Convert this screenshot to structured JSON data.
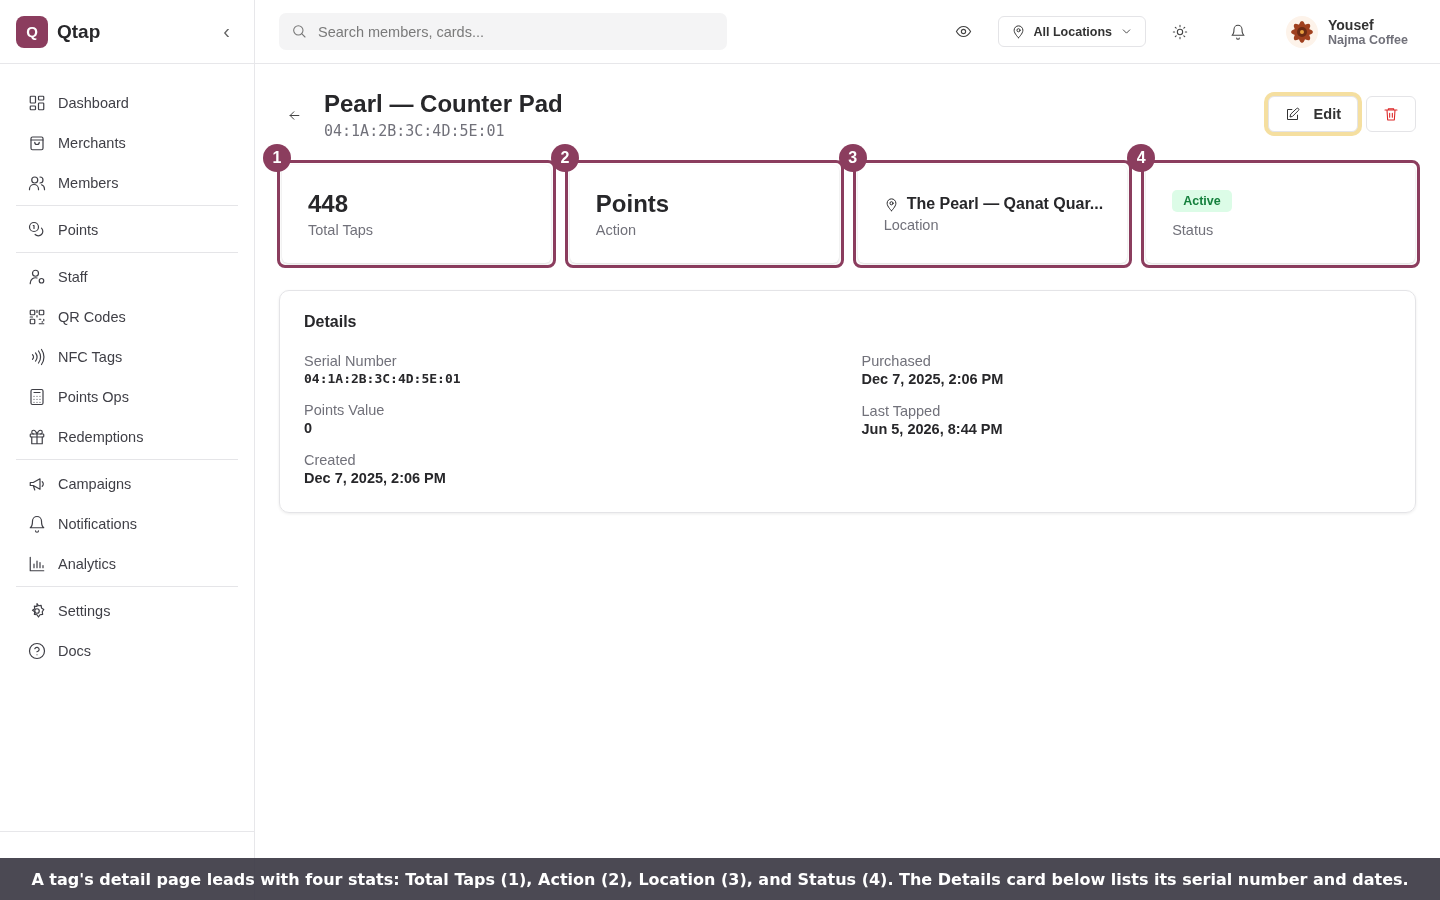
{
  "sidebar": {
    "logo_letter": "Q",
    "brand": "Qtap",
    "collapse": "‹",
    "groups": [
      [
        {
          "label": "Dashboard"
        },
        {
          "label": "Merchants"
        },
        {
          "label": "Members"
        }
      ],
      [
        {
          "label": "Points"
        }
      ],
      [
        {
          "label": "Staff"
        },
        {
          "label": "QR Codes"
        },
        {
          "label": "NFC Tags"
        },
        {
          "label": "Points Ops"
        },
        {
          "label": "Redemptions"
        }
      ],
      [
        {
          "label": "Campaigns"
        },
        {
          "label": "Notifications"
        },
        {
          "label": "Analytics"
        }
      ],
      [
        {
          "label": "Settings"
        },
        {
          "label": "Docs"
        }
      ]
    ]
  },
  "topbar": {
    "search": {
      "placeholder": "Search members, cards..."
    },
    "location": "All Locations",
    "user": {
      "name": "Yousef",
      "org": "Najma Coffee"
    }
  },
  "header": {
    "title": "Pearl — Counter Pad",
    "serial": "04:1A:2B:3C:4D:5E:01",
    "edit": {
      "label": "Edit",
      "highlighted": true
    }
  },
  "stats": [
    {
      "kind": "number",
      "marker": "1",
      "value": "448",
      "label": "Total Taps"
    },
    {
      "kind": "text",
      "marker": "2",
      "value": "Points",
      "label": "Action"
    },
    {
      "kind": "location",
      "marker": "3",
      "value": "The Pearl — Qanat Quar...",
      "label": "Location"
    },
    {
      "kind": "badge",
      "marker": "4",
      "value": "Active",
      "label": "Status",
      "color": "#dcfce7"
    }
  ],
  "details": {
    "title": "Details",
    "columns": [
      [
        {
          "label": "Serial Number",
          "value": "04:1A:2B:3C:4D:5E:01",
          "mono": true
        },
        {
          "label": "Points Value",
          "value": "0",
          "mono": false
        },
        {
          "label": "Created",
          "value": "Dec 7, 2025, 2:06 PM",
          "mono": false
        }
      ],
      [
        {
          "label": "Purchased",
          "value": "Dec 7, 2025, 2:06 PM",
          "mono": false
        },
        {
          "label": "Last Tapped",
          "value": "Jun 5, 2026, 8:44 PM",
          "mono": false
        }
      ]
    ]
  },
  "caption": "A tag's detail page leads with four stats: Total Taps (1), Action (2), Location (3), and Status (4). The Details card below lists its serial number and dates."
}
